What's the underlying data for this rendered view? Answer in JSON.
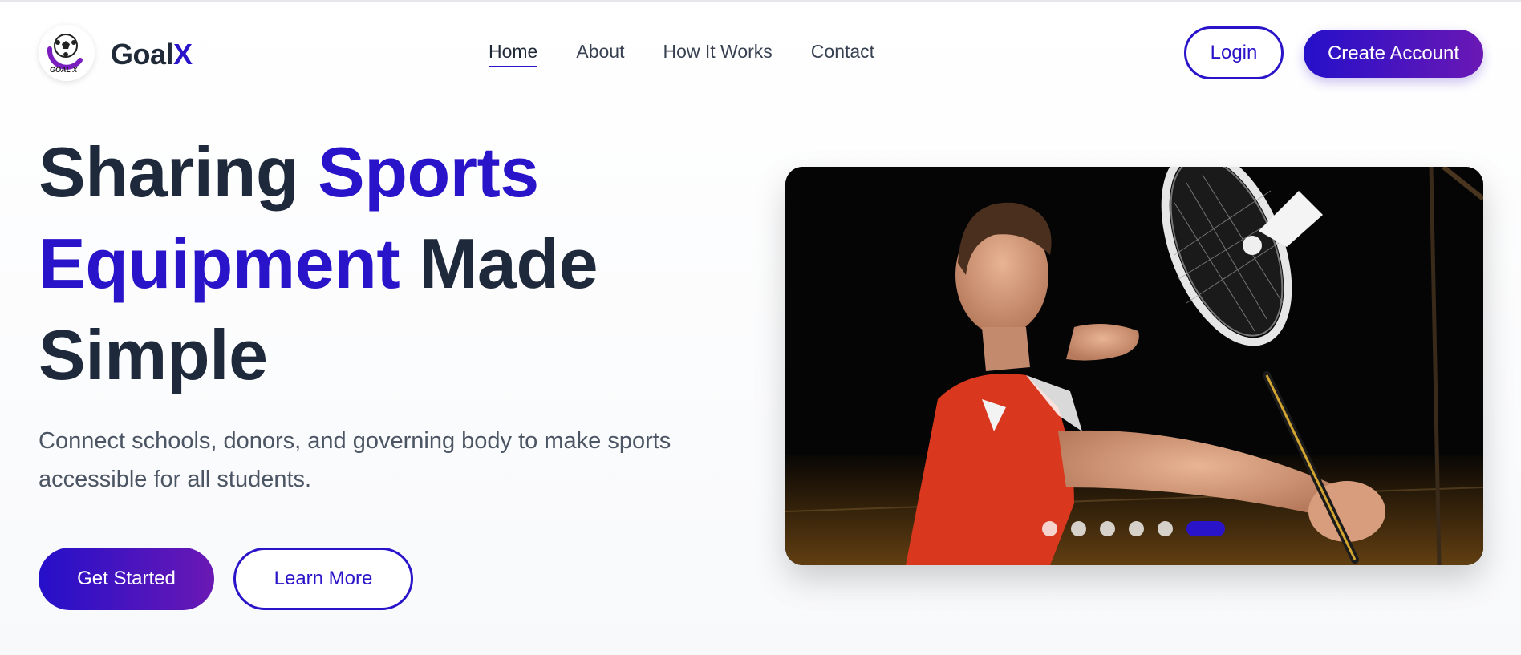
{
  "brand": {
    "name_main": "Goal",
    "name_accent": "X",
    "logo_text": "GOAL X"
  },
  "nav": {
    "items": [
      {
        "label": "Home",
        "active": true
      },
      {
        "label": "About",
        "active": false
      },
      {
        "label": "How It Works",
        "active": false
      },
      {
        "label": "Contact",
        "active": false
      }
    ]
  },
  "header_actions": {
    "login_label": "Login",
    "create_account_label": "Create Account"
  },
  "hero": {
    "title_part1": "Sharing ",
    "title_highlight1": "Sports",
    "title_highlight2": "Equipment",
    "title_part2": " Made",
    "title_part3": "Simple",
    "subtitle": "Connect schools, donors, and governing body to make sports accessible for all students.",
    "get_started_label": "Get Started",
    "learn_more_label": "Learn More"
  },
  "carousel": {
    "slide_count": 6,
    "active_index": 5,
    "image_subject": "badminton player in red shirt hitting shuttlecock"
  },
  "colors": {
    "accent": "#2a14c9",
    "gradient_end": "#6a18b4",
    "heading": "#1e293b",
    "body_text": "#4b5563"
  }
}
